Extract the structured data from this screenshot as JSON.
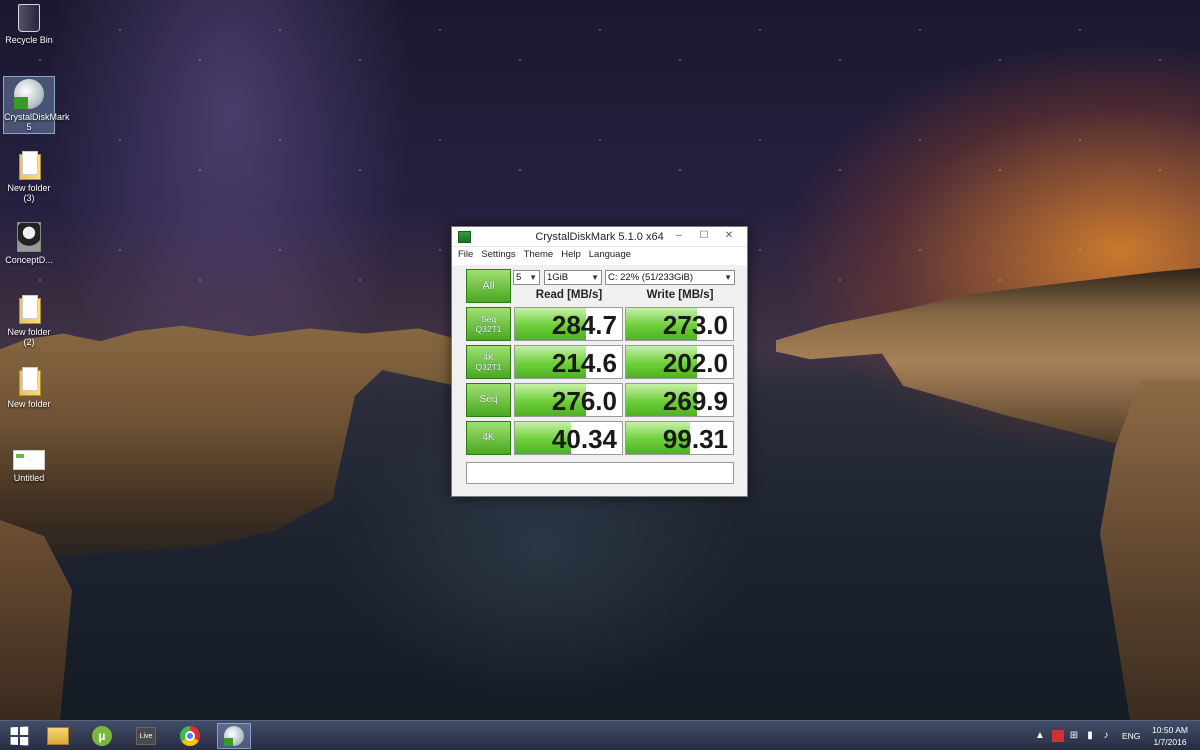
{
  "desktop": {
    "icons": [
      {
        "label": "Recycle Bin",
        "icon": "recycle-bin-icon"
      },
      {
        "label": "CrystalDiskMark 5",
        "icon": "crystaldiskmark-icon"
      },
      {
        "label": "New folder (3)",
        "icon": "folder-icon"
      },
      {
        "label": "ConceptD...",
        "icon": "person-icon"
      },
      {
        "label": "New folder (2)",
        "icon": "folder-icon"
      },
      {
        "label": "New folder",
        "icon": "folder-icon"
      },
      {
        "label": "Untitled",
        "icon": "image-file-icon"
      }
    ]
  },
  "window": {
    "title": "CrystalDiskMark 5.1.0 x64",
    "controls": {
      "minimize": "–",
      "maximize": "☐",
      "close": "✕"
    },
    "menu": [
      "File",
      "Settings",
      "Theme",
      "Help",
      "Language"
    ],
    "all_label": "All",
    "count_select": "5",
    "size_select": "1GiB",
    "drive_select": "C: 22% (51/233GiB)",
    "read_header": "Read [MB/s]",
    "write_header": "Write [MB/s]",
    "tests": [
      {
        "label_line1": "Seq",
        "label_line2": "Q32T1",
        "read": "284.7",
        "write": "273.0"
      },
      {
        "label_line1": "4K",
        "label_line2": "Q32T1",
        "read": "214.6",
        "write": "202.0"
      },
      {
        "label_line1": "Seq",
        "label_line2": "",
        "read": "276.0",
        "write": "269.9"
      },
      {
        "label_line1": "4K",
        "label_line2": "",
        "read": "40.34",
        "write": "99.31"
      }
    ],
    "comment": ""
  },
  "taskbar": {
    "apps": [
      {
        "name": "start",
        "icon": "windows-logo-icon"
      },
      {
        "name": "file-explorer",
        "icon": "file-explorer-icon"
      },
      {
        "name": "utorrent",
        "icon": "utorrent-icon",
        "text": "µ"
      },
      {
        "name": "live",
        "icon": "live-icon",
        "text": "Live"
      },
      {
        "name": "chrome",
        "icon": "chrome-icon"
      },
      {
        "name": "crystaldiskmark",
        "icon": "crystaldiskmark-icon",
        "active": true
      }
    ],
    "language": "ENG",
    "time": "10:50 AM",
    "date": "1/7/2016"
  },
  "colors": {
    "accent_green": "#49a81f",
    "bar_green": "#6dcf3a",
    "taskbar": "#2e3550"
  }
}
